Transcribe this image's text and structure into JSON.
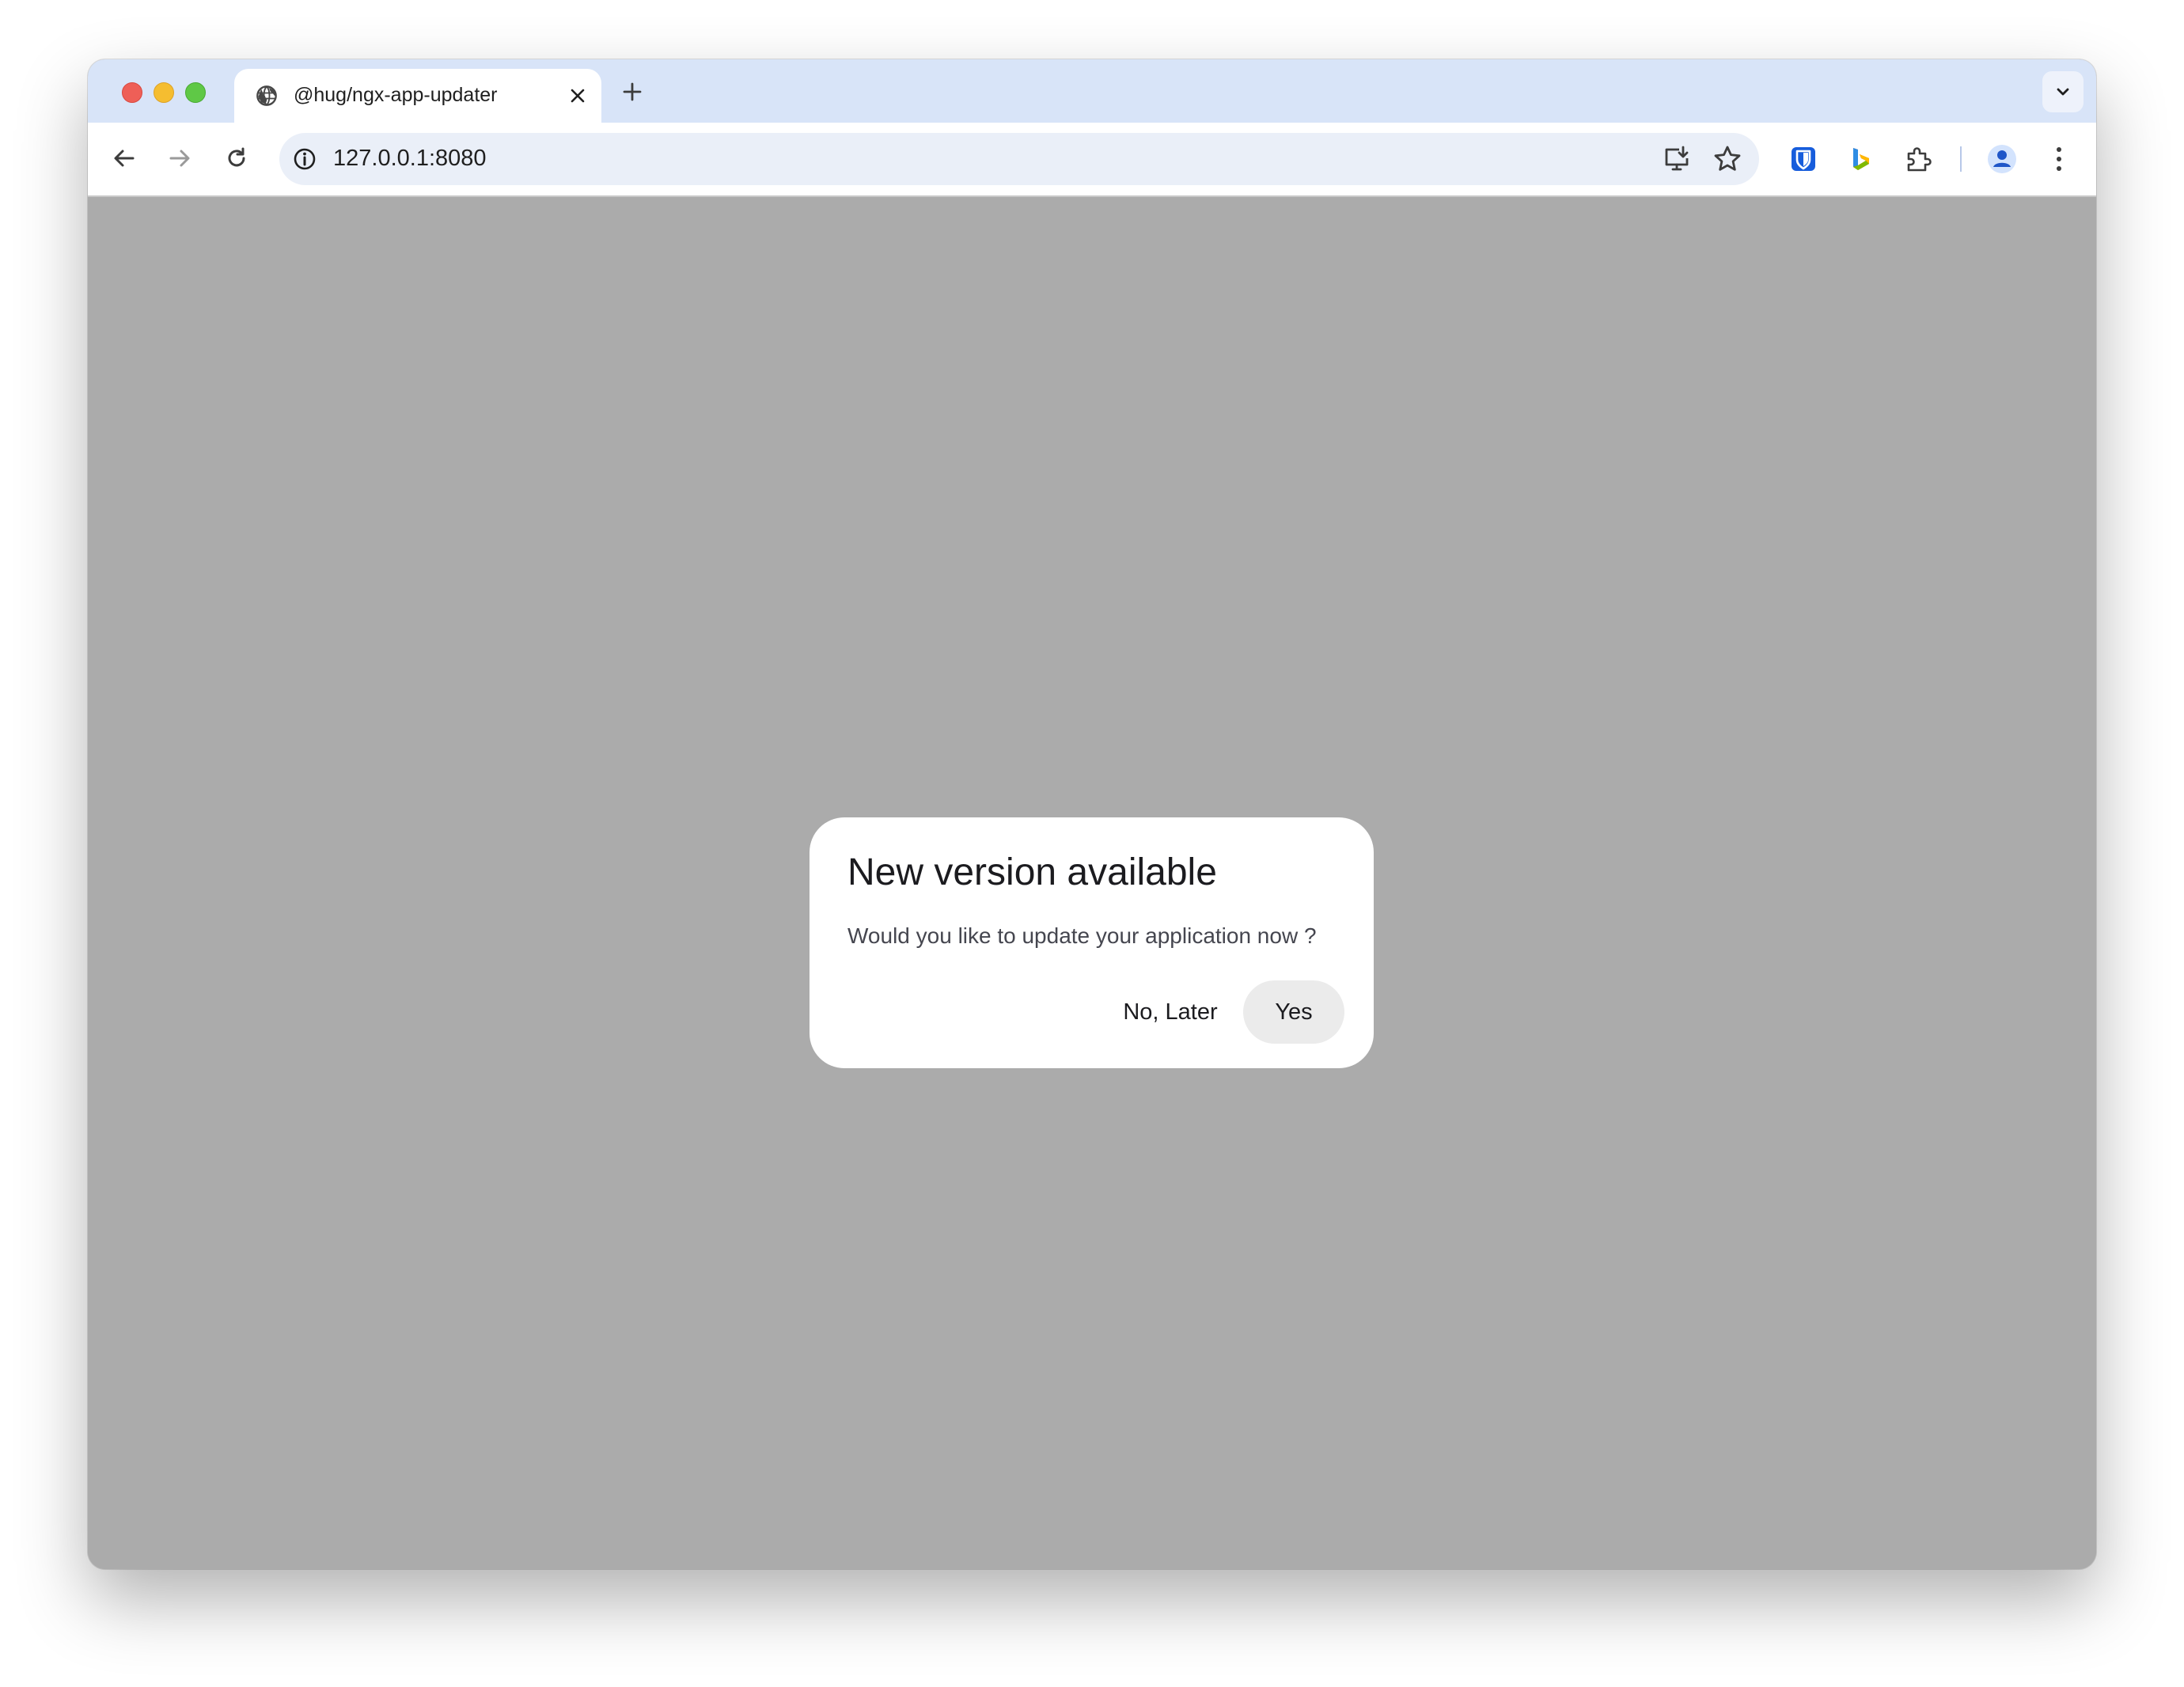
{
  "browser": {
    "tab": {
      "title": "@hug/ngx-app-updater"
    },
    "address_bar": {
      "url": "127.0.0.1:8080"
    },
    "colors": {
      "titlebar": "#d8e4f8",
      "omnibox": "#eaeff8",
      "bitwarden": "#175ddc",
      "page_overlay": "#ababab"
    },
    "icons": {
      "tab_favicon": "globe-icon",
      "tab_close": "close-icon",
      "new_tab": "plus-icon",
      "tab_search": "chevron-down-icon",
      "back": "arrow-left-icon",
      "forward": "arrow-right-icon",
      "reload": "reload-icon",
      "site_info": "info-icon",
      "install": "install-app-icon",
      "bookmark": "star-icon",
      "extension_1": "bitwarden-shield-icon",
      "extension_2": "bing-icon",
      "extensions": "puzzle-icon",
      "profile": "avatar-icon",
      "menu": "more-vertical-icon"
    }
  },
  "dialog": {
    "title": "New version available",
    "message": "Would you like to update your application now ?",
    "cancel_label": "No, Later",
    "confirm_label": "Yes"
  }
}
